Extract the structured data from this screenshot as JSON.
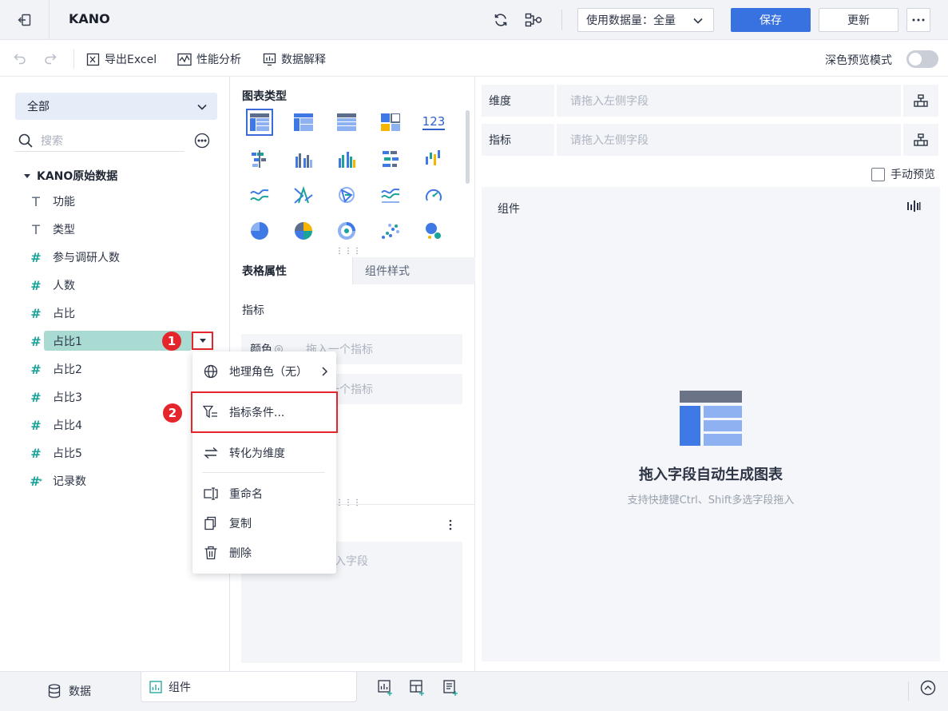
{
  "topbar": {
    "title": "KANO",
    "data_amount_label": "使用数据量：全量",
    "save_label": "保存",
    "update_label": "更新",
    "icons": [
      "back-icon",
      "refresh-icon",
      "relation-icon",
      "chevron-down-icon",
      "more-icon"
    ]
  },
  "toolbar": {
    "export_label": "导出Excel",
    "perf_label": "性能分析",
    "explain_label": "数据解释",
    "dark_preview_label": "深色预览模式",
    "dark_preview_on": false
  },
  "left": {
    "dataset_selected": "全部",
    "search_placeholder": "搜索",
    "root_label": "KANO原始数据",
    "fields": [
      {
        "type": "text",
        "label": "功能"
      },
      {
        "type": "text",
        "label": "类型"
      },
      {
        "type": "number",
        "label": "参与调研人数"
      },
      {
        "type": "number",
        "label": "人数"
      },
      {
        "type": "number",
        "label": "占比"
      },
      {
        "type": "number",
        "label": "占比1",
        "selected": true
      },
      {
        "type": "number",
        "label": "占比2"
      },
      {
        "type": "number",
        "label": "占比3"
      },
      {
        "type": "number",
        "label": "占比4"
      },
      {
        "type": "number",
        "label": "占比5"
      },
      {
        "type": "count",
        "label": "记录数"
      }
    ]
  },
  "steps": {
    "step1": "1",
    "step2": "2"
  },
  "middle": {
    "chart_type_title": "图表类型",
    "chart_types": [
      "table",
      "cross-table",
      "detail-table",
      "treemap",
      "kpi-number",
      "grouped-bar",
      "bar",
      "grouped-column",
      "horizontal-bar",
      "waterfall",
      "line",
      "radar",
      "polar",
      "area",
      "gauge",
      "pie",
      "rose",
      "donut",
      "scatter",
      "bubble"
    ],
    "kpi_text": "123",
    "tab_table_props": "表格属性",
    "tab_component_style": "组件样式",
    "measure_title": "指标",
    "color_slot_label": "颜色",
    "color_slot_placeholder": "拖入一个指标",
    "size_slot_placeholder": "拖入一个指标",
    "field_drop_placeholder": "拖入字段"
  },
  "right": {
    "dimension_label": "维度",
    "dimension_placeholder": "请拖入左侧字段",
    "measure_label": "指标",
    "measure_placeholder": "请拖入左侧字段",
    "manual_preview_label": "手动预览",
    "canvas_title": "组件",
    "empty_title": "拖入字段自动生成图表",
    "empty_subtitle": "支持快捷键Ctrl、Shift多选字段拖入"
  },
  "context_menu": {
    "items": [
      {
        "label": "地理角色（无）",
        "icon": "globe-icon",
        "has_submenu": true
      },
      {
        "label": "指标条件...",
        "icon": "filter-icon"
      },
      {
        "label": "转化为维度",
        "icon": "swap-icon"
      },
      {
        "label": "重命名",
        "icon": "rename-icon"
      },
      {
        "label": "复制",
        "icon": "copy-icon"
      },
      {
        "label": "删除",
        "icon": "trash-icon"
      }
    ]
  },
  "bottom": {
    "tab_data": "数据",
    "tab_component": "组件"
  },
  "colors": {
    "accent": "#3871e0",
    "selected_field": "#a9dbd3",
    "highlight_red": "#e4262c",
    "number_field": "#1aa39a"
  }
}
